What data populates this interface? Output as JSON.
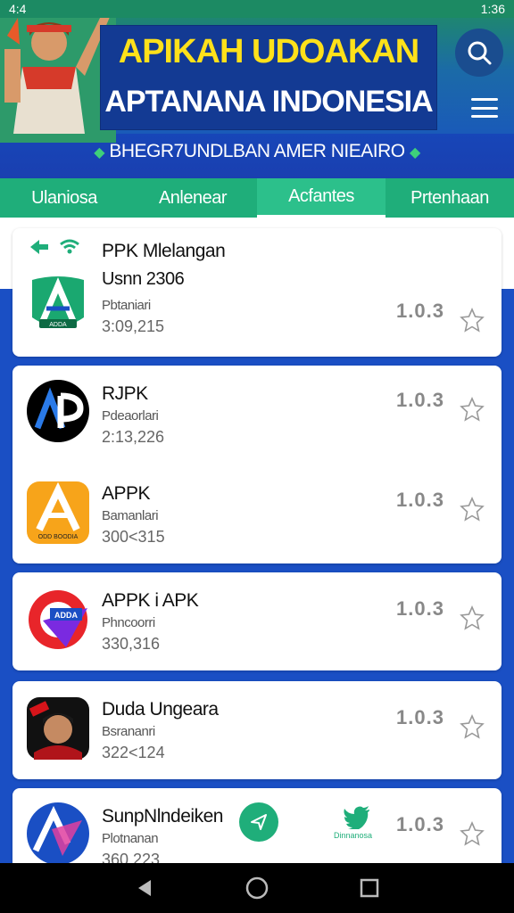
{
  "status": {
    "left": "4:4",
    "right": "1:36"
  },
  "header": {
    "title_line1": "APIKAH UDOAKAN",
    "title_line2": "APTANANA INDONESIA",
    "subtitle": "BHEGR7UNDLBAN AMER NIEAIRO"
  },
  "tabs": [
    {
      "label": "Ulaniosa"
    },
    {
      "label": "Anlenear"
    },
    {
      "label": "Acfantes"
    },
    {
      "label": "Prtenhaan"
    }
  ],
  "apps": [
    {
      "name": "PPK Mlelangan",
      "sub1": "Usnn 2306",
      "sub": "Pbtaniari",
      "num": "3:09,215",
      "version": "1.0.3",
      "icon_text": "ADDA"
    },
    {
      "name": "RJPK",
      "sub": "Pdeaorlari",
      "num": "2:13,226",
      "version": "1.0.3",
      "icon_text": ""
    },
    {
      "name": "APPK",
      "sub": "Bamanlari",
      "num": "300<315",
      "version": "1.0.3",
      "icon_text": "ODD BOODIA"
    },
    {
      "name": "APPK i APK",
      "sub": "Phncoorri",
      "num": "330,316",
      "version": "1.0.3",
      "icon_text": "ADDA"
    },
    {
      "name": "Duda Ungeara",
      "sub": "Bsrananri",
      "num": "322<124",
      "version": "1.0.3",
      "icon_text": ""
    },
    {
      "name": "SunpNlndeiken",
      "sub": "Plotnanan",
      "num": "360,223",
      "version": "1.0.3",
      "icon_text": "",
      "extra_label": "Dinnanosa"
    }
  ],
  "colors": {
    "brand_green": "#1fae7a",
    "brand_blue": "#1a4fc4",
    "title_yellow": "#ffe11a"
  }
}
